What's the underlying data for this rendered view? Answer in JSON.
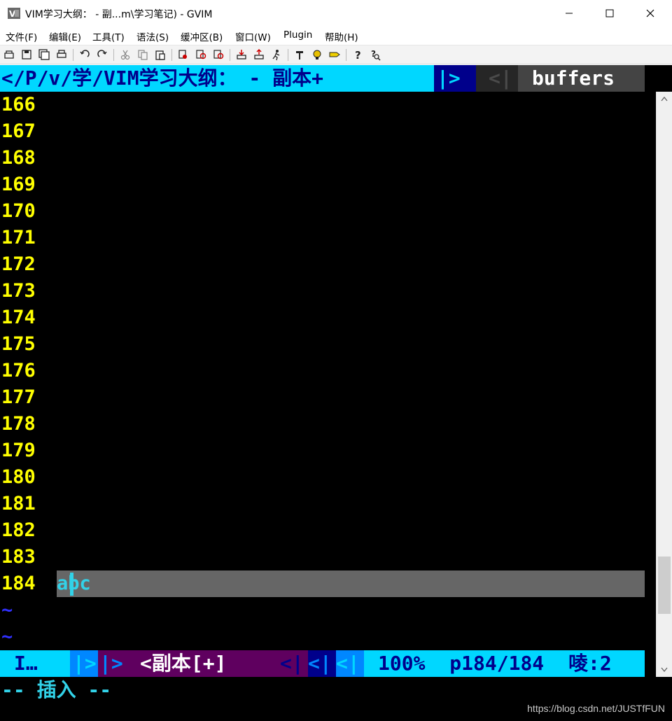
{
  "window": {
    "title": "VIM学习大纲：  - 副...m\\学习笔记) - GVIM"
  },
  "menu": {
    "items": [
      "文件(F)",
      "编辑(E)",
      "工具(T)",
      "语法(S)",
      "缓冲区(B)",
      "窗口(W)",
      "Plugin",
      "帮助(H)"
    ]
  },
  "toolbar": {
    "icons": [
      "open-icon",
      "save-icon",
      "save-all-icon",
      "print-icon",
      "undo-icon",
      "redo-icon",
      "cut-icon",
      "copy-icon",
      "paste-icon",
      "replace-icon",
      "find-next-icon",
      "find-prev-icon",
      "load-session-icon",
      "save-session-icon",
      "run-script-icon",
      "make-icon",
      "run-ctags-icon",
      "tag-jump-icon",
      "help-icon",
      "find-help-icon"
    ]
  },
  "tabline": {
    "path": "</P/v/学/VIM学习大纲：  - 副本+",
    "sep_right": "|>",
    "sep_left": "<|",
    "buffers_label": "buffers"
  },
  "editor": {
    "line_numbers": [
      "166",
      "167",
      "168",
      "169",
      "170",
      "171",
      "172",
      "173",
      "174",
      "175",
      "176",
      "177",
      "178",
      "179",
      "180",
      "181",
      "182",
      "183",
      "184"
    ],
    "current_line_text": "abc",
    "tildes": [
      "~",
      "~"
    ],
    "colors": {
      "line_number": "#ffff00",
      "text": "#32d2e8",
      "tilde": "#3030ff",
      "cursorline_bg": "#666666",
      "background": "#000000"
    }
  },
  "statusline": {
    "mode": "I…",
    "sep1": "|>",
    "sep2": "|>",
    "filename": "<副本[+]",
    "sep3": "<|",
    "sep4": "<|",
    "sep5": "<|",
    "percent": "100%",
    "position": "p184/184",
    "column": "㖫:2",
    "colors": {
      "cyan": "#00d7ff",
      "purple": "#5f005f",
      "navy": "#00008b",
      "blue": "#0087ff"
    }
  },
  "cmdline": {
    "mode_text": "-- 插入 --"
  },
  "watermark": "https://blog.csdn.net/JUSTfFUN"
}
